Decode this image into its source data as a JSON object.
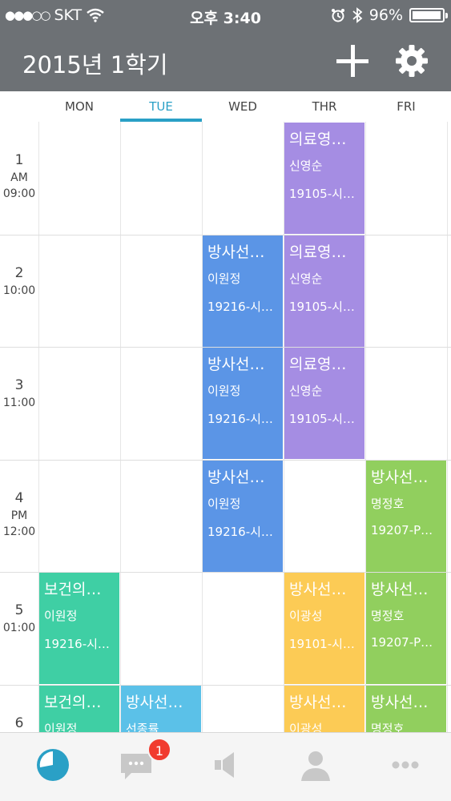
{
  "status_bar": {
    "carrier": "SKT",
    "signal_dots": "●●●○○",
    "time": "오후 3:40",
    "battery_percent_label": "96%",
    "battery_level": 0.96
  },
  "nav": {
    "title": "2015년 1학기",
    "add_icon": "plus-icon",
    "settings_icon": "gear-icon"
  },
  "days": [
    "MON",
    "TUE",
    "WED",
    "THR",
    "FRI"
  ],
  "active_day": "TUE",
  "periods": [
    {
      "num": "1",
      "ampm": "AM",
      "time": "09:00"
    },
    {
      "num": "2",
      "ampm": "",
      "time": "10:00"
    },
    {
      "num": "3",
      "ampm": "",
      "time": "11:00"
    },
    {
      "num": "4",
      "ampm": "PM",
      "time": "12:00"
    },
    {
      "num": "5",
      "ampm": "",
      "time": "01:00"
    },
    {
      "num": "6",
      "ampm": "",
      "time": ""
    }
  ],
  "colors": {
    "purple": "#a58de3",
    "blue": "#5b95e6",
    "green": "#91cf5e",
    "teal": "#3fcfa4",
    "cyan": "#5bc1e8",
    "yellow": "#fccb55",
    "active_tab": "#2aa0c6",
    "badge": "#f13b2f"
  },
  "classes": [
    {
      "day": 3,
      "period": 0,
      "title": "의료영…",
      "prof": "신영순",
      "room": "19105-시…",
      "color": "#a58de3"
    },
    {
      "day": 3,
      "period": 1,
      "title": "의료영…",
      "prof": "신영순",
      "room": "19105-시…",
      "color": "#a58de3"
    },
    {
      "day": 3,
      "period": 2,
      "title": "의료영…",
      "prof": "신영순",
      "room": "19105-시…",
      "color": "#a58de3"
    },
    {
      "day": 2,
      "period": 1,
      "title": "방사선…",
      "prof": "이원정",
      "room": "19216-시…",
      "color": "#5b95e6"
    },
    {
      "day": 2,
      "period": 2,
      "title": "방사선…",
      "prof": "이원정",
      "room": "19216-시…",
      "color": "#5b95e6"
    },
    {
      "day": 2,
      "period": 3,
      "title": "방사선…",
      "prof": "이원정",
      "room": "19216-시…",
      "color": "#5b95e6"
    },
    {
      "day": 4,
      "period": 3,
      "title": "방사선…",
      "prof": "명정호",
      "room": "19207-P…",
      "color": "#91cf5e"
    },
    {
      "day": 4,
      "period": 4,
      "title": "방사선…",
      "prof": "명정호",
      "room": "19207-P…",
      "color": "#91cf5e"
    },
    {
      "day": 4,
      "period": 5,
      "title": "방사선…",
      "prof": "명정호",
      "room": "",
      "color": "#91cf5e"
    },
    {
      "day": 0,
      "period": 4,
      "title": "보건의…",
      "prof": "이원정",
      "room": "19216-시…",
      "color": "#3fcfa4"
    },
    {
      "day": 0,
      "period": 5,
      "title": "보건의…",
      "prof": "이원정",
      "room": "",
      "color": "#3fcfa4"
    },
    {
      "day": 3,
      "period": 4,
      "title": "방사선…",
      "prof": "이광성",
      "room": "19101-시…",
      "color": "#fccb55"
    },
    {
      "day": 3,
      "period": 5,
      "title": "방사선…",
      "prof": "이광성",
      "room": "",
      "color": "#fccb55"
    },
    {
      "day": 1,
      "period": 5,
      "title": "방사선…",
      "prof": "선종률",
      "room": "",
      "color": "#5bc1e8"
    }
  ],
  "tabbar": {
    "tabs": [
      {
        "icon": "timetable-clock-icon",
        "active": true
      },
      {
        "icon": "chat-bubble-icon",
        "badge": "1"
      },
      {
        "icon": "megaphone-icon"
      },
      {
        "icon": "person-icon"
      },
      {
        "icon": "more-dots-icon"
      }
    ]
  }
}
